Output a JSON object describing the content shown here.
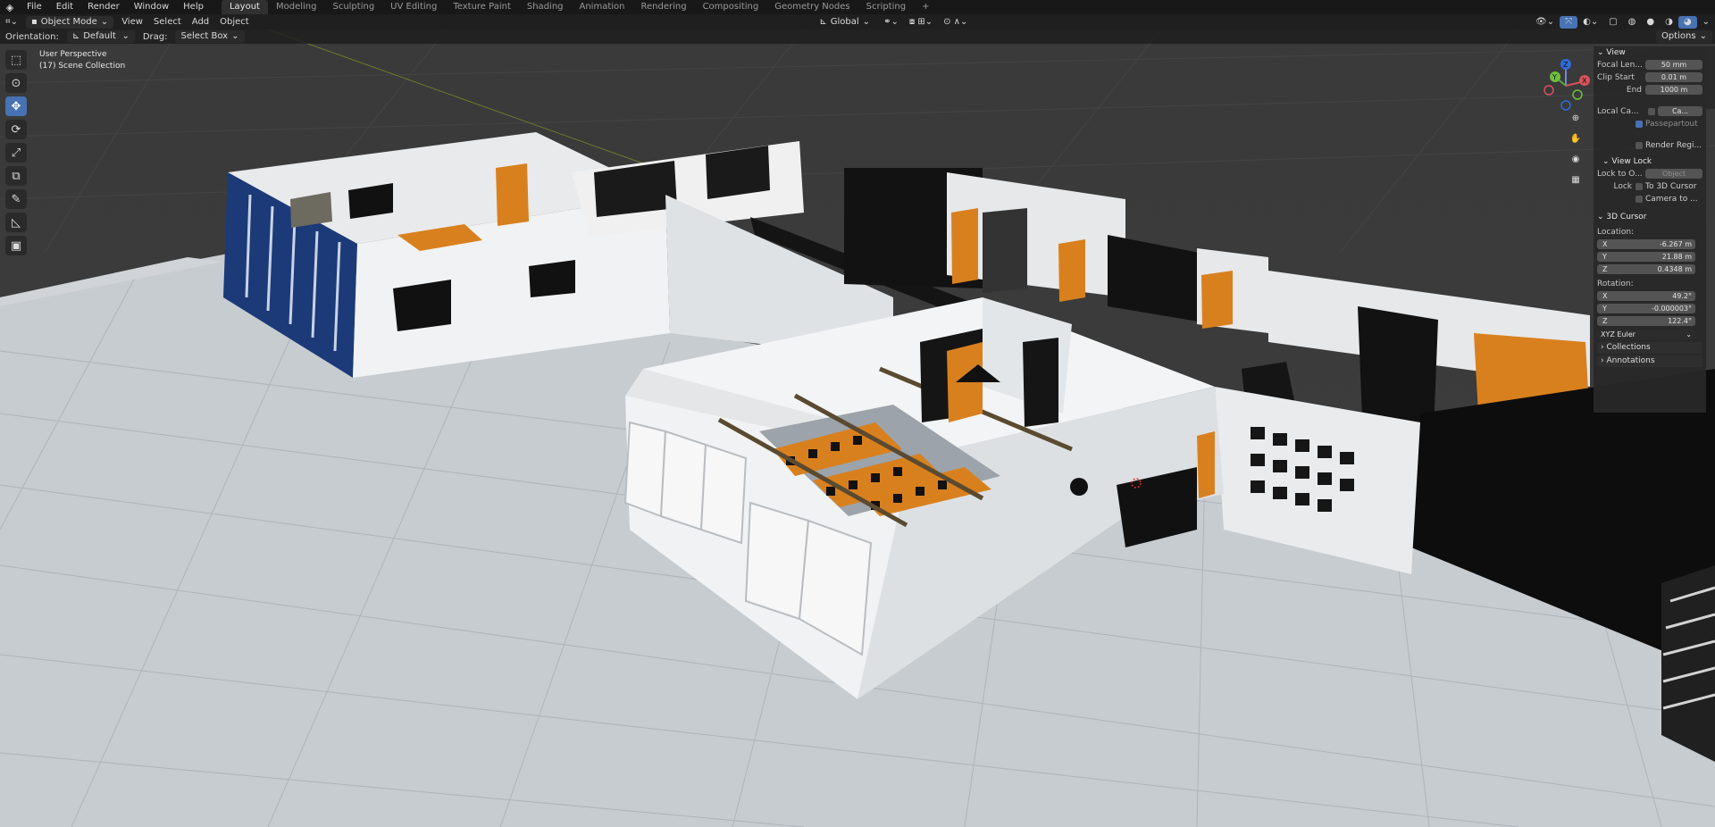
{
  "menu": {
    "logo": "◈",
    "items": [
      "File",
      "Edit",
      "Render",
      "Window",
      "Help"
    ]
  },
  "workspaces": [
    "Layout",
    "Modeling",
    "Sculpting",
    "UV Editing",
    "Texture Paint",
    "Shading",
    "Animation",
    "Rendering",
    "Compositing",
    "Geometry Nodes",
    "Scripting",
    "+"
  ],
  "header": {
    "mode": "Object Mode",
    "view": "View",
    "select": "Select",
    "add": "Add",
    "object": "Object",
    "transform_orientation": "Global",
    "options": "Options"
  },
  "tool_header": {
    "orientation_label": "Orientation:",
    "orientation_value": "Default",
    "drag_label": "Drag:",
    "drag_value": "Select Box"
  },
  "viewport": {
    "perspective": "User Perspective",
    "collection": "(17) Scene Collection"
  },
  "npanel": {
    "view_header": "View",
    "focal_label": "Focal Len...",
    "focal_value": "50 mm",
    "clip_start_label": "Clip Start",
    "clip_start_value": "0.01 m",
    "clip_end_label": "End",
    "clip_end_value": "1000 m",
    "local_cam_label": "Local Ca...",
    "local_cam_value": "Ca...",
    "passepartout": "Passepartout",
    "render_region": "Render Regi...",
    "view_lock_header": "View Lock",
    "lock_to_obj_label": "Lock to O...",
    "lock_to_obj_value": "Object",
    "lock_label": "Lock",
    "to_3d_cursor": "To 3D Cursor",
    "camera_to": "Camera to ...",
    "cursor_header": "3D Cursor",
    "location_label": "Location:",
    "loc_x": "-6.267 m",
    "loc_y": "21.88 m",
    "loc_z": "0.4348 m",
    "rotation_label": "Rotation:",
    "rot_x": "49.2°",
    "rot_y": "-0.000003°",
    "rot_z": "122.4°",
    "rotation_mode": "XYZ Euler",
    "collections": "Collections",
    "annotations": "Annotations"
  },
  "gizmo": {
    "x": "X",
    "y": "Y",
    "z": "Z"
  },
  "colors": {
    "accent": "#4772b3",
    "wood": "#d9801e",
    "floor": "#c9ced3"
  }
}
